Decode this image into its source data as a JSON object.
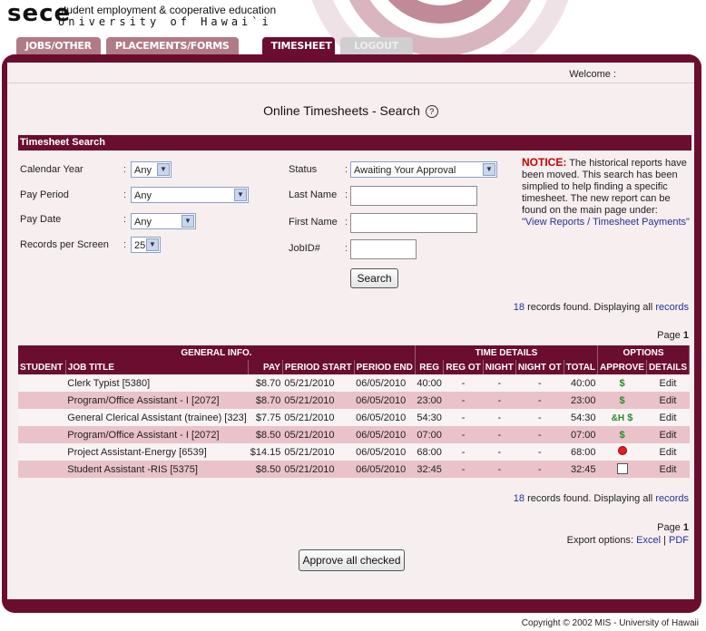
{
  "header": {
    "logo": "sece",
    "org_line1": "student employment & cooperative education",
    "org_line2": "University of Hawai`i",
    "tabs": [
      "JOBS/OTHER",
      "PLACEMENTS/FORMS",
      "TIMESHEET",
      "LOGOUT"
    ],
    "active_tab": "TIMESHEET"
  },
  "welcome": "Welcome :",
  "page_title": "Online Timesheets - Search",
  "search": {
    "section_title": "Timesheet Search",
    "calendar_year_label": "Calendar Year",
    "calendar_year_value": "Any",
    "pay_period_label": "Pay Period",
    "pay_period_value": "Any",
    "pay_date_label": "Pay Date",
    "pay_date_value": "Any",
    "records_label": "Records per Screen",
    "records_value": "25",
    "status_label": "Status",
    "status_value": "Awaiting Your Approval",
    "last_name_label": "Last Name",
    "first_name_label": "First Name",
    "jobid_label": "JobID#",
    "search_button": "Search"
  },
  "notice": {
    "title": "NOTICE:",
    "text": "The historical reports have been moved. This search has been simplied to help finding a specific timesheet. The new report can be found on the main page under:",
    "link": "\"View Reports / Timesheet Payments\""
  },
  "records_found": {
    "count": "18",
    "text": "records found. Displaying all",
    "link": "records"
  },
  "page_label": "Page",
  "page_number": "1",
  "table": {
    "group_headers": [
      "GENERAL INFO.",
      "TIME DETAILS",
      "OPTIONS"
    ],
    "columns": [
      "STUDENT",
      "JOB TITLE",
      "PAY",
      "PERIOD START",
      "PERIOD END",
      "REG",
      "REG OT",
      "NIGHT",
      "NIGHT OT",
      "TOTAL",
      "APPROVE",
      "DETAILS"
    ],
    "rows": [
      {
        "student": "",
        "job": "Clerk Typist [5380]",
        "pay": "$8.70",
        "start": "05/21/2010",
        "end": "06/05/2010",
        "reg": "40:00",
        "regot": "-",
        "night": "-",
        "nightot": "-",
        "total": "40:00",
        "approve": "dollar",
        "details": "Edit"
      },
      {
        "student": "",
        "job": "Program/Office Assistant - I [2072]",
        "pay": "$8.70",
        "start": "05/21/2010",
        "end": "06/05/2010",
        "reg": "23:00",
        "regot": "-",
        "night": "-",
        "nightot": "-",
        "total": "23:00",
        "approve": "dollar",
        "details": "Edit"
      },
      {
        "student": "",
        "job": "General Clerical Assistant (trainee) [323]",
        "pay": "$7.75",
        "start": "05/21/2010",
        "end": "06/05/2010",
        "reg": "54:30",
        "regot": "-",
        "night": "-",
        "nightot": "-",
        "total": "54:30",
        "approve": "hold-dollar",
        "details": "Edit"
      },
      {
        "student": "",
        "job": "Program/Office Assistant - I [2072]",
        "pay": "$8.50",
        "start": "05/21/2010",
        "end": "06/05/2010",
        "reg": "07:00",
        "regot": "-",
        "night": "-",
        "nightot": "-",
        "total": "07:00",
        "approve": "dollar",
        "details": "Edit"
      },
      {
        "student": "",
        "job": "Project Assistant-Energy [6539]",
        "pay": "$14.15",
        "start": "05/21/2010",
        "end": "06/05/2010",
        "reg": "68:00",
        "regot": "-",
        "night": "-",
        "nightot": "-",
        "total": "68:00",
        "approve": "stop",
        "details": "Edit"
      },
      {
        "student": "",
        "job": "Student Assistant -RIS [5375]",
        "pay": "$8.50",
        "start": "05/21/2010",
        "end": "06/05/2010",
        "reg": "32:45",
        "regot": "-",
        "night": "-",
        "nightot": "-",
        "total": "32:45",
        "approve": "checkbox",
        "details": "Edit"
      }
    ]
  },
  "export": {
    "label": "Export options:",
    "excel": "Excel",
    "sep": "|",
    "pdf": "PDF"
  },
  "approve_all_button": "Approve all checked",
  "copyright": "Copyright © 2002 MIS - University of Hawaii",
  "colors": {
    "maroon": "#6b0d2f",
    "pink_row": "#e9c3c9",
    "light_bg": "#f7eef0",
    "link": "#223399"
  }
}
